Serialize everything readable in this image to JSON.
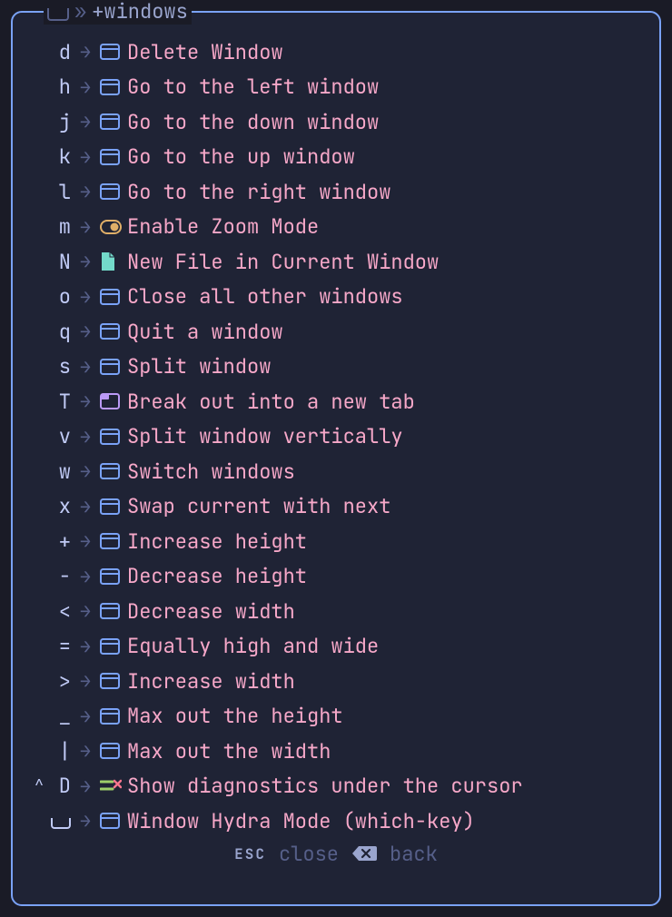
{
  "header": {
    "prefix_glyph": "space",
    "chevron": "»",
    "title": "+windows"
  },
  "items": [
    {
      "caret": "",
      "key": "d",
      "icon": "window",
      "desc": "Delete Window"
    },
    {
      "caret": "",
      "key": "h",
      "icon": "window",
      "desc": "Go to the left window"
    },
    {
      "caret": "",
      "key": "j",
      "icon": "window",
      "desc": "Go to the down window"
    },
    {
      "caret": "",
      "key": "k",
      "icon": "window",
      "desc": "Go to the up window"
    },
    {
      "caret": "",
      "key": "l",
      "icon": "window",
      "desc": "Go to the right window"
    },
    {
      "caret": "",
      "key": "m",
      "icon": "toggle",
      "desc": "Enable Zoom Mode"
    },
    {
      "caret": "",
      "key": "N",
      "icon": "file",
      "desc": " New File in Current Window"
    },
    {
      "caret": "",
      "key": "o",
      "icon": "window",
      "desc": "Close all other windows"
    },
    {
      "caret": "",
      "key": "q",
      "icon": "window",
      "desc": "Quit a window"
    },
    {
      "caret": "",
      "key": "s",
      "icon": "window",
      "desc": "Split window"
    },
    {
      "caret": "",
      "key": "T",
      "icon": "tab",
      "desc": "Break out into a new tab"
    },
    {
      "caret": "",
      "key": "v",
      "icon": "window",
      "desc": "Split window vertically"
    },
    {
      "caret": "",
      "key": "w",
      "icon": "window",
      "desc": "Switch windows"
    },
    {
      "caret": "",
      "key": "x",
      "icon": "window",
      "desc": "Swap current with next"
    },
    {
      "caret": "",
      "key": "+",
      "icon": "window",
      "desc": "Increase height"
    },
    {
      "caret": "",
      "key": "-",
      "icon": "window",
      "desc": "Decrease height"
    },
    {
      "caret": "",
      "key": "<",
      "icon": "window",
      "desc": "Decrease width"
    },
    {
      "caret": "",
      "key": "=",
      "icon": "window",
      "desc": "Equally high and wide"
    },
    {
      "caret": "",
      "key": ">",
      "icon": "window",
      "desc": "Increase width"
    },
    {
      "caret": "",
      "key": "_",
      "icon": "window",
      "desc": "Max out the height"
    },
    {
      "caret": "",
      "key": "|",
      "icon": "window",
      "desc": "Max out the width"
    },
    {
      "caret": "^",
      "key": "D",
      "icon": "diag",
      "desc": " Show diagnostics under the cursor"
    },
    {
      "caret": "",
      "key": "␣",
      "icon": "window",
      "desc": "Window Hydra Mode (which-key)"
    }
  ],
  "footer": {
    "esc_key": "ESC",
    "esc_label": "close",
    "back_key": "backspace",
    "back_label": "back"
  },
  "arrow": "→"
}
